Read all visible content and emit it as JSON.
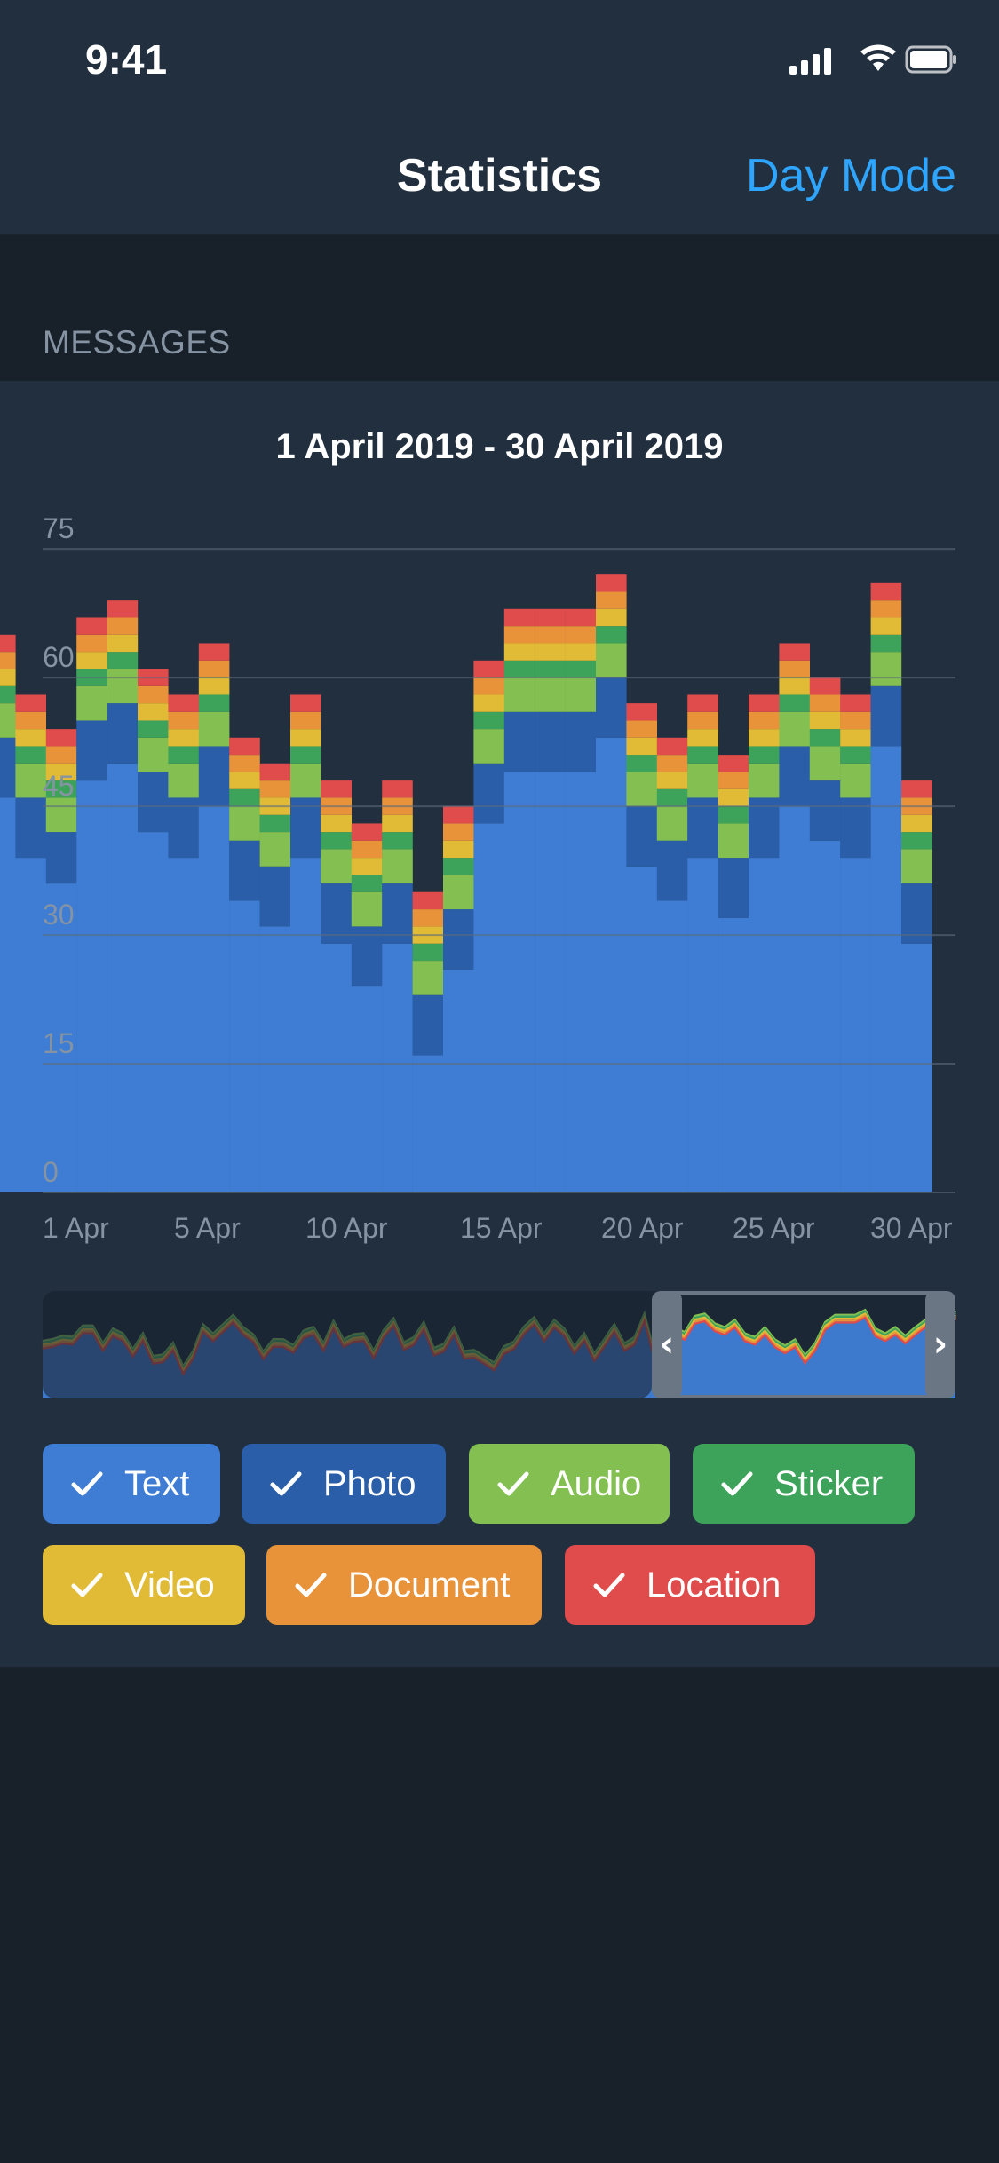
{
  "status_bar": {
    "time": "9:41",
    "icons": [
      "signal-icon",
      "wifi-icon",
      "battery-icon"
    ]
  },
  "nav": {
    "title": "Statistics",
    "action": "Day Mode"
  },
  "section": {
    "header": "MESSAGES"
  },
  "card": {
    "range": "1 April 2019 - 30 April 2019"
  },
  "colors": {
    "background": "#18202a",
    "card": "#222f3f",
    "accent": "#2ea6ff",
    "grid": "#3b4a5c",
    "axis_text": "#8593a3"
  },
  "chart_data": {
    "type": "area",
    "stacked": true,
    "x": [
      "1 Apr",
      "2 Apr",
      "3 Apr",
      "4 Apr",
      "5 Apr",
      "6 Apr",
      "7 Apr",
      "8 Apr",
      "9 Apr",
      "10 Apr",
      "11 Apr",
      "12 Apr",
      "13 Apr",
      "14 Apr",
      "15 Apr",
      "16 Apr",
      "17 Apr",
      "18 Apr",
      "19 Apr",
      "20 Apr",
      "21 Apr",
      "22 Apr",
      "23 Apr",
      "24 Apr",
      "25 Apr",
      "26 Apr",
      "27 Apr",
      "28 Apr",
      "29 Apr",
      "30 Apr",
      "1 May"
    ],
    "x_tick_labels": [
      "1 Apr",
      "5 Apr",
      "10 Apr",
      "15 Apr",
      "20 Apr",
      "25 Apr",
      "30 Apr"
    ],
    "y_ticks": [
      0,
      15,
      30,
      45,
      60,
      75
    ],
    "ylim": [
      0,
      78
    ],
    "grid": true,
    "series": [
      {
        "name": "Text",
        "color": "#3e7dd3",
        "values": [
          46,
          39,
          36,
          48,
          50,
          42,
          39,
          45,
          34,
          31,
          39,
          29,
          24,
          29,
          16,
          26,
          43,
          49,
          49,
          49,
          53,
          38,
          34,
          39,
          32,
          39,
          45,
          41,
          39,
          52,
          29
        ]
      },
      {
        "name": "Photo",
        "color": "#2a5ea8",
        "values": [
          7,
          7,
          6,
          7,
          7,
          7,
          7,
          7,
          7,
          7,
          7,
          7,
          7,
          7,
          7,
          7,
          7,
          7,
          7,
          7,
          7,
          7,
          7,
          7,
          7,
          7,
          7,
          7,
          7,
          7,
          7
        ]
      },
      {
        "name": "Audio",
        "color": "#84c051",
        "values": [
          4,
          4,
          4,
          4,
          4,
          4,
          4,
          4,
          4,
          4,
          4,
          4,
          4,
          4,
          4,
          4,
          4,
          4,
          4,
          4,
          4,
          4,
          4,
          4,
          4,
          4,
          4,
          4,
          4,
          4,
          4
        ]
      },
      {
        "name": "Sticker",
        "color": "#3da35a",
        "values": [
          2,
          2,
          2,
          2,
          2,
          2,
          2,
          2,
          2,
          2,
          2,
          2,
          2,
          2,
          2,
          2,
          2,
          2,
          2,
          2,
          2,
          2,
          2,
          2,
          2,
          2,
          2,
          2,
          2,
          2,
          2
        ]
      },
      {
        "name": "Video",
        "color": "#e1bb35",
        "values": [
          2,
          2,
          2,
          2,
          2,
          2,
          2,
          2,
          2,
          2,
          2,
          2,
          2,
          2,
          2,
          2,
          2,
          2,
          2,
          2,
          2,
          2,
          2,
          2,
          2,
          2,
          2,
          2,
          2,
          2,
          2
        ]
      },
      {
        "name": "Document",
        "color": "#e8923a",
        "values": [
          2,
          2,
          2,
          2,
          2,
          2,
          2,
          2,
          2,
          2,
          2,
          2,
          2,
          2,
          2,
          2,
          2,
          2,
          2,
          2,
          2,
          2,
          2,
          2,
          2,
          2,
          2,
          2,
          2,
          2,
          2
        ]
      },
      {
        "name": "Location",
        "color": "#e04b4b",
        "values": [
          2,
          2,
          2,
          2,
          2,
          2,
          2,
          2,
          2,
          2,
          2,
          2,
          2,
          2,
          2,
          2,
          2,
          2,
          2,
          2,
          2,
          2,
          2,
          2,
          2,
          2,
          2,
          2,
          2,
          2,
          2
        ]
      }
    ]
  },
  "filters": [
    {
      "label": "Text",
      "checked": true
    },
    {
      "label": "Photo",
      "checked": true
    },
    {
      "label": "Audio",
      "checked": true
    },
    {
      "label": "Sticker",
      "checked": true
    },
    {
      "label": "Video",
      "checked": true
    },
    {
      "label": "Document",
      "checked": true
    },
    {
      "label": "Location",
      "checked": true
    }
  ],
  "navigator": {
    "left_handle": "‹",
    "right_handle": "›"
  }
}
